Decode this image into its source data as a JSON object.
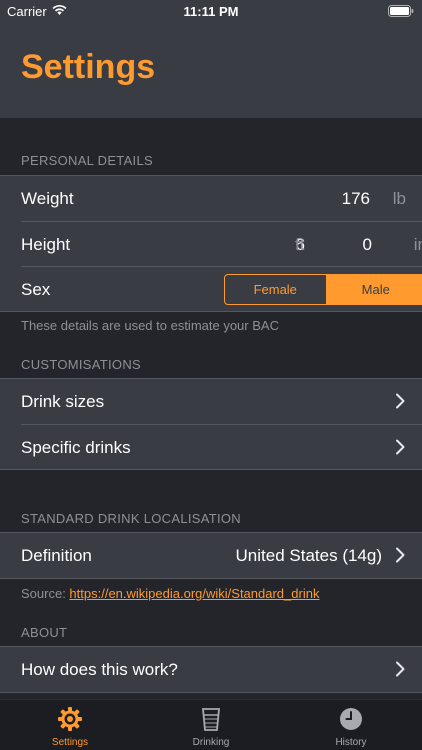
{
  "status_bar": {
    "carrier": "Carrier",
    "time": "11:11 PM"
  },
  "header": {
    "title": "Settings"
  },
  "personal": {
    "header": "PERSONAL DETAILS",
    "weight_label": "Weight",
    "weight_value": "176",
    "weight_unit": "lb",
    "height_label": "Height",
    "height_ft_value": "6",
    "height_ft_unit": "ft",
    "height_in_value": "0",
    "height_in_unit": "in",
    "sex_label": "Sex",
    "sex_options": [
      "Female",
      "Male"
    ],
    "sex_selected": "Male",
    "footnote": "These details are used to estimate your BAC"
  },
  "customisations": {
    "header": "CUSTOMISATIONS",
    "items": [
      "Drink sizes",
      "Specific drinks"
    ]
  },
  "localisation": {
    "header": "STANDARD DRINK LOCALISATION",
    "definition_label": "Definition",
    "definition_value": "United States (14g)",
    "source_prefix": "Source: ",
    "source_link": "https://en.wikipedia.org/wiki/Standard_drink"
  },
  "about": {
    "header": "ABOUT",
    "items": [
      "How does this work?"
    ]
  },
  "tab_bar": {
    "tabs": [
      {
        "label": "Settings",
        "icon": "gear-icon"
      },
      {
        "label": "Drinking",
        "icon": "glass-icon"
      },
      {
        "label": "History",
        "icon": "clock-icon"
      }
    ],
    "active": "Settings"
  },
  "colors": {
    "accent": "#ff9a2e",
    "background": "#24252b",
    "cell": "#3a3c44",
    "secondary_text": "#8e9098"
  }
}
